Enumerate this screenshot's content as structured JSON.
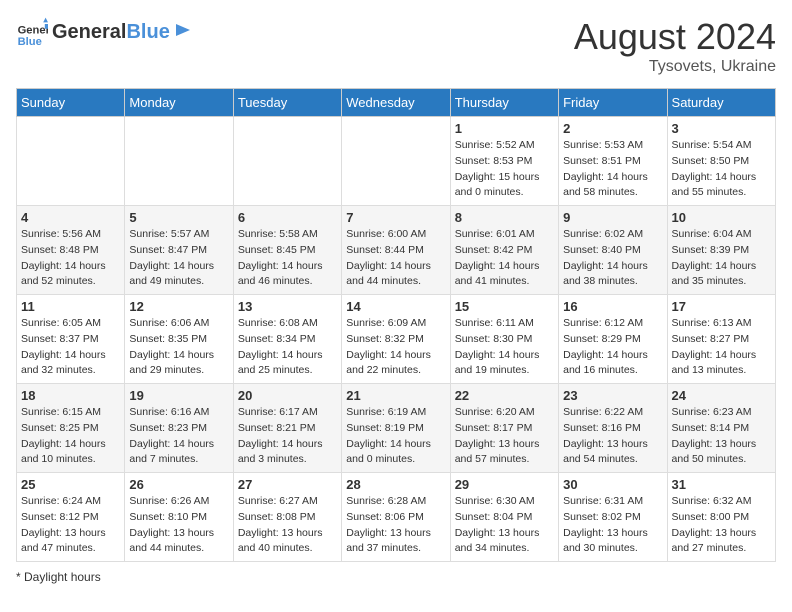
{
  "header": {
    "logo_general": "General",
    "logo_blue": "Blue",
    "month_title": "August 2024",
    "location": "Tysovets, Ukraine"
  },
  "footer": {
    "note": "Daylight hours"
  },
  "weekdays": [
    "Sunday",
    "Monday",
    "Tuesday",
    "Wednesday",
    "Thursday",
    "Friday",
    "Saturday"
  ],
  "weeks": [
    [
      {
        "day": "",
        "sunrise": "",
        "sunset": "",
        "daylight": ""
      },
      {
        "day": "",
        "sunrise": "",
        "sunset": "",
        "daylight": ""
      },
      {
        "day": "",
        "sunrise": "",
        "sunset": "",
        "daylight": ""
      },
      {
        "day": "",
        "sunrise": "",
        "sunset": "",
        "daylight": ""
      },
      {
        "day": "1",
        "sunrise": "Sunrise: 5:52 AM",
        "sunset": "Sunset: 8:53 PM",
        "daylight": "Daylight: 15 hours and 0 minutes."
      },
      {
        "day": "2",
        "sunrise": "Sunrise: 5:53 AM",
        "sunset": "Sunset: 8:51 PM",
        "daylight": "Daylight: 14 hours and 58 minutes."
      },
      {
        "day": "3",
        "sunrise": "Sunrise: 5:54 AM",
        "sunset": "Sunset: 8:50 PM",
        "daylight": "Daylight: 14 hours and 55 minutes."
      }
    ],
    [
      {
        "day": "4",
        "sunrise": "Sunrise: 5:56 AM",
        "sunset": "Sunset: 8:48 PM",
        "daylight": "Daylight: 14 hours and 52 minutes."
      },
      {
        "day": "5",
        "sunrise": "Sunrise: 5:57 AM",
        "sunset": "Sunset: 8:47 PM",
        "daylight": "Daylight: 14 hours and 49 minutes."
      },
      {
        "day": "6",
        "sunrise": "Sunrise: 5:58 AM",
        "sunset": "Sunset: 8:45 PM",
        "daylight": "Daylight: 14 hours and 46 minutes."
      },
      {
        "day": "7",
        "sunrise": "Sunrise: 6:00 AM",
        "sunset": "Sunset: 8:44 PM",
        "daylight": "Daylight: 14 hours and 44 minutes."
      },
      {
        "day": "8",
        "sunrise": "Sunrise: 6:01 AM",
        "sunset": "Sunset: 8:42 PM",
        "daylight": "Daylight: 14 hours and 41 minutes."
      },
      {
        "day": "9",
        "sunrise": "Sunrise: 6:02 AM",
        "sunset": "Sunset: 8:40 PM",
        "daylight": "Daylight: 14 hours and 38 minutes."
      },
      {
        "day": "10",
        "sunrise": "Sunrise: 6:04 AM",
        "sunset": "Sunset: 8:39 PM",
        "daylight": "Daylight: 14 hours and 35 minutes."
      }
    ],
    [
      {
        "day": "11",
        "sunrise": "Sunrise: 6:05 AM",
        "sunset": "Sunset: 8:37 PM",
        "daylight": "Daylight: 14 hours and 32 minutes."
      },
      {
        "day": "12",
        "sunrise": "Sunrise: 6:06 AM",
        "sunset": "Sunset: 8:35 PM",
        "daylight": "Daylight: 14 hours and 29 minutes."
      },
      {
        "day": "13",
        "sunrise": "Sunrise: 6:08 AM",
        "sunset": "Sunset: 8:34 PM",
        "daylight": "Daylight: 14 hours and 25 minutes."
      },
      {
        "day": "14",
        "sunrise": "Sunrise: 6:09 AM",
        "sunset": "Sunset: 8:32 PM",
        "daylight": "Daylight: 14 hours and 22 minutes."
      },
      {
        "day": "15",
        "sunrise": "Sunrise: 6:11 AM",
        "sunset": "Sunset: 8:30 PM",
        "daylight": "Daylight: 14 hours and 19 minutes."
      },
      {
        "day": "16",
        "sunrise": "Sunrise: 6:12 AM",
        "sunset": "Sunset: 8:29 PM",
        "daylight": "Daylight: 14 hours and 16 minutes."
      },
      {
        "day": "17",
        "sunrise": "Sunrise: 6:13 AM",
        "sunset": "Sunset: 8:27 PM",
        "daylight": "Daylight: 14 hours and 13 minutes."
      }
    ],
    [
      {
        "day": "18",
        "sunrise": "Sunrise: 6:15 AM",
        "sunset": "Sunset: 8:25 PM",
        "daylight": "Daylight: 14 hours and 10 minutes."
      },
      {
        "day": "19",
        "sunrise": "Sunrise: 6:16 AM",
        "sunset": "Sunset: 8:23 PM",
        "daylight": "Daylight: 14 hours and 7 minutes."
      },
      {
        "day": "20",
        "sunrise": "Sunrise: 6:17 AM",
        "sunset": "Sunset: 8:21 PM",
        "daylight": "Daylight: 14 hours and 3 minutes."
      },
      {
        "day": "21",
        "sunrise": "Sunrise: 6:19 AM",
        "sunset": "Sunset: 8:19 PM",
        "daylight": "Daylight: 14 hours and 0 minutes."
      },
      {
        "day": "22",
        "sunrise": "Sunrise: 6:20 AM",
        "sunset": "Sunset: 8:17 PM",
        "daylight": "Daylight: 13 hours and 57 minutes."
      },
      {
        "day": "23",
        "sunrise": "Sunrise: 6:22 AM",
        "sunset": "Sunset: 8:16 PM",
        "daylight": "Daylight: 13 hours and 54 minutes."
      },
      {
        "day": "24",
        "sunrise": "Sunrise: 6:23 AM",
        "sunset": "Sunset: 8:14 PM",
        "daylight": "Daylight: 13 hours and 50 minutes."
      }
    ],
    [
      {
        "day": "25",
        "sunrise": "Sunrise: 6:24 AM",
        "sunset": "Sunset: 8:12 PM",
        "daylight": "Daylight: 13 hours and 47 minutes."
      },
      {
        "day": "26",
        "sunrise": "Sunrise: 6:26 AM",
        "sunset": "Sunset: 8:10 PM",
        "daylight": "Daylight: 13 hours and 44 minutes."
      },
      {
        "day": "27",
        "sunrise": "Sunrise: 6:27 AM",
        "sunset": "Sunset: 8:08 PM",
        "daylight": "Daylight: 13 hours and 40 minutes."
      },
      {
        "day": "28",
        "sunrise": "Sunrise: 6:28 AM",
        "sunset": "Sunset: 8:06 PM",
        "daylight": "Daylight: 13 hours and 37 minutes."
      },
      {
        "day": "29",
        "sunrise": "Sunrise: 6:30 AM",
        "sunset": "Sunset: 8:04 PM",
        "daylight": "Daylight: 13 hours and 34 minutes."
      },
      {
        "day": "30",
        "sunrise": "Sunrise: 6:31 AM",
        "sunset": "Sunset: 8:02 PM",
        "daylight": "Daylight: 13 hours and 30 minutes."
      },
      {
        "day": "31",
        "sunrise": "Sunrise: 6:32 AM",
        "sunset": "Sunset: 8:00 PM",
        "daylight": "Daylight: 13 hours and 27 minutes."
      }
    ]
  ]
}
